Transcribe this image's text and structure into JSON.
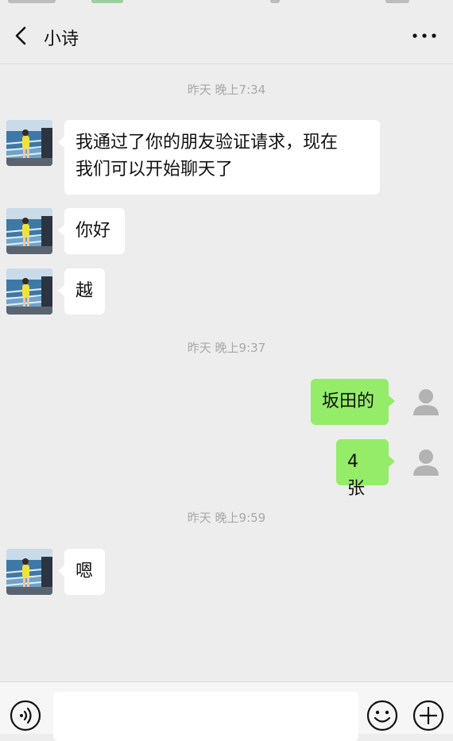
{
  "header": {
    "title": "小诗",
    "back_icon": "chevron-left-icon",
    "more_icon": "more-horizontal-icon"
  },
  "timestamps": [
    "昨天 晚上7:34",
    "昨天 晚上9:37",
    "昨天 晚上9:59"
  ],
  "messages": [
    {
      "sender": "them",
      "text_line1": "我通过了你的朋友验证请求，现在",
      "text_line2": "我们可以开始聊天了"
    },
    {
      "sender": "them",
      "text": "你好"
    },
    {
      "sender": "them",
      "text": "越"
    },
    {
      "sender": "me",
      "text": "坂田的"
    },
    {
      "sender": "me",
      "text": "4 张"
    },
    {
      "sender": "them",
      "text": "嗯"
    }
  ],
  "composer": {
    "input_value": "",
    "voice_icon": "voice-icon",
    "emoji_icon": "emoji-icon",
    "plus_icon": "plus-icon"
  },
  "colors": {
    "background": "#ededed",
    "bubble_them": "#ffffff",
    "bubble_me": "#95ec69",
    "timestamp": "#a8a8a8"
  }
}
